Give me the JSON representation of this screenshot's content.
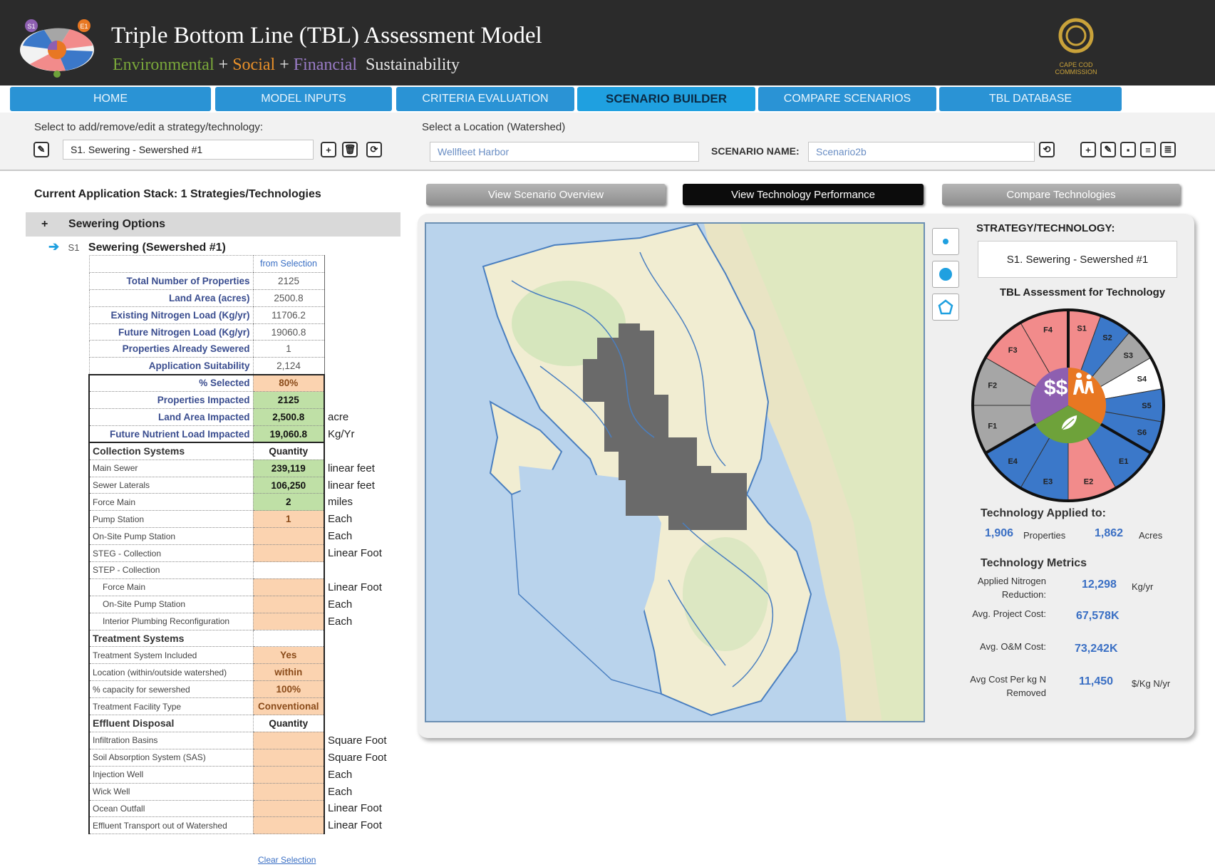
{
  "header": {
    "title": "Triple Bottom Line (TBL) Assessment Model",
    "subtitle_env": "Environmental",
    "subtitle_plus1": "+",
    "subtitle_soc": "Social",
    "subtitle_plus2": "+",
    "subtitle_fin": "Financial",
    "subtitle_sus": "Sustainability",
    "logo_badges": [
      "S1",
      "E1"
    ],
    "org_logo_text": "CAPE COD COMMISSION"
  },
  "nav": {
    "tabs": [
      "HOME",
      "MODEL INPUTS",
      "CRITERIA EVALUATION",
      "SCENARIO BUILDER",
      "COMPARE SCENARIOS",
      "TBL DATABASE"
    ],
    "active_tab": "SCENARIO BUILDER"
  },
  "toolbar": {
    "strategy_label": "Select to add/remove/edit  a strategy/technology:",
    "strategy_value": "S1. Sewering - Sewershed #1",
    "location_label": "Select a Location (Watershed)",
    "location_value": "Wellfleet Harbor",
    "scenario_name_label": "SCENARIO NAME:",
    "scenario_name_value": "Scenario2b"
  },
  "stack": {
    "title": "Current Application Stack: 1 Strategies/Technologies",
    "group_toggle": "+",
    "group_label": "Sewering Options",
    "item_code": "S1",
    "item_label": "Sewering (Sewershed #1)"
  },
  "table": {
    "header": "from Selection",
    "info_rows": [
      {
        "label": "Total Number of Properties",
        "value": "2125"
      },
      {
        "label": "Land Area (acres)",
        "value": "2500.8"
      },
      {
        "label": "Existing Nitrogen Load (Kg/yr)",
        "value": "11706.2"
      },
      {
        "label": "Future Nitrogen Load (Kg/yr)",
        "value": "19060.8"
      },
      {
        "label": "Properties Already Sewered",
        "value": "1"
      },
      {
        "label": "Application Suitability",
        "value": "2,124"
      }
    ],
    "impact_rows": [
      {
        "label": "% Selected",
        "value": "80%",
        "unit": ""
      },
      {
        "label": "Properties Impacted",
        "value": "2125",
        "unit": ""
      },
      {
        "label": "Land Area Impacted",
        "value": "2,500.8",
        "unit": "acre"
      },
      {
        "label": "Future Nutrient Load Impacted",
        "value": "19,060.8",
        "unit": "Kg/Yr"
      }
    ],
    "collection_header": "Collection Systems",
    "collection_qty": "Quantity",
    "collection_rows": [
      {
        "label": "Main Sewer",
        "value": "239,119",
        "unit": "linear feet"
      },
      {
        "label": "Sewer Laterals",
        "value": "106,250",
        "unit": "linear feet"
      },
      {
        "label": "Force Main",
        "value": "2",
        "unit": "miles"
      },
      {
        "label": "Pump Station",
        "value": "1",
        "unit": "Each"
      },
      {
        "label": "On-Site Pump Station",
        "value": "",
        "unit": "Each"
      },
      {
        "label": "STEG - Collection",
        "value": "",
        "unit": "Linear Foot"
      },
      {
        "label": "STEP - Collection",
        "value": "",
        "unit": ""
      },
      {
        "label": "Force Main",
        "value": "",
        "unit": "Linear Foot"
      },
      {
        "label": "On-Site Pump Station",
        "value": "",
        "unit": "Each"
      },
      {
        "label": "Interior Plumbing Reconfiguration",
        "value": "",
        "unit": "Each"
      }
    ],
    "treatment_header": "Treatment Systems",
    "treatment_rows": [
      {
        "label": "Treatment System Included",
        "value": "Yes"
      },
      {
        "label": "Location (within/outside watershed)",
        "value": "within"
      },
      {
        "label": "% capacity for sewershed",
        "value": "100%"
      },
      {
        "label": "Treatment Facility Type",
        "value": "Conventional"
      }
    ],
    "effluent_header": "Effluent Disposal",
    "effluent_qty": "Quantity",
    "effluent_rows": [
      {
        "label": "Infiltration Basins",
        "unit": "Square Foot"
      },
      {
        "label": "Soil Absorption System (SAS)",
        "unit": "Square Foot"
      },
      {
        "label": "Injection Well",
        "unit": "Each"
      },
      {
        "label": "Wick Well",
        "unit": "Each"
      },
      {
        "label": "Ocean Outfall",
        "unit": "Linear Foot"
      },
      {
        "label": "Effluent Transport out of Watershed",
        "unit": "Linear Foot"
      }
    ],
    "clear_selection": "Clear Selection"
  },
  "view_buttons": [
    "View Scenario Overview",
    "View Technology Performance",
    "Compare Technologies"
  ],
  "right": {
    "strategy_label": "STRATEGY/TECHNOLOGY:",
    "strategy_value": "S1. Sewering - Sewershed #1",
    "wheel_title": "TBL Assessment for Technology",
    "wheel_labels": [
      "S1",
      "S2",
      "S3",
      "S4",
      "S5",
      "S6",
      "E1",
      "E2",
      "E3",
      "E4",
      "F1",
      "F2",
      "F3",
      "F4"
    ],
    "wheel_center": "$$",
    "applied_title": "Technology Applied to:",
    "applied_properties_value": "1,906",
    "applied_properties_label": "Properties",
    "applied_acres_value": "1,862",
    "applied_acres_label": "Acres",
    "metrics_title": "Technology Metrics",
    "metrics": [
      {
        "label": "Applied Nitrogen Reduction:",
        "value": "12,298",
        "unit": "Kg/yr"
      },
      {
        "label": "Avg. Project Cost:",
        "value": "67,578K",
        "unit": ""
      },
      {
        "label": "Avg. O&M Cost:",
        "value": "73,242K",
        "unit": ""
      },
      {
        "label": "Avg Cost Per kg N Removed",
        "value": "11,450",
        "unit": "$/Kg N/yr"
      }
    ]
  },
  "colors": {
    "header_bg": "#2b2b2b",
    "nav_tab": "#2a93d5",
    "accent_blue": "#3a6fc4",
    "peach": "#fbd3b0",
    "green": "#bfe0a6",
    "wheel_red": "#f28b8b",
    "wheel_blue": "#3b78c9",
    "wheel_gray": "#a6a6a6",
    "center_purple": "#8e5fb0",
    "center_orange": "#e87722",
    "center_green": "#6ea23a"
  },
  "icons": [
    "tbl-logo-icon",
    "edit-icon",
    "add-icon",
    "delete-icon",
    "refresh-icon",
    "scenario-icon",
    "new-file-icon",
    "edit-file-icon",
    "save-file-icon",
    "copy-file-icon",
    "print-file-icon",
    "point-select-icon",
    "circle-select-icon",
    "polygon-select-icon",
    "arrow-right-icon",
    "leaf-icon",
    "people-icon"
  ]
}
